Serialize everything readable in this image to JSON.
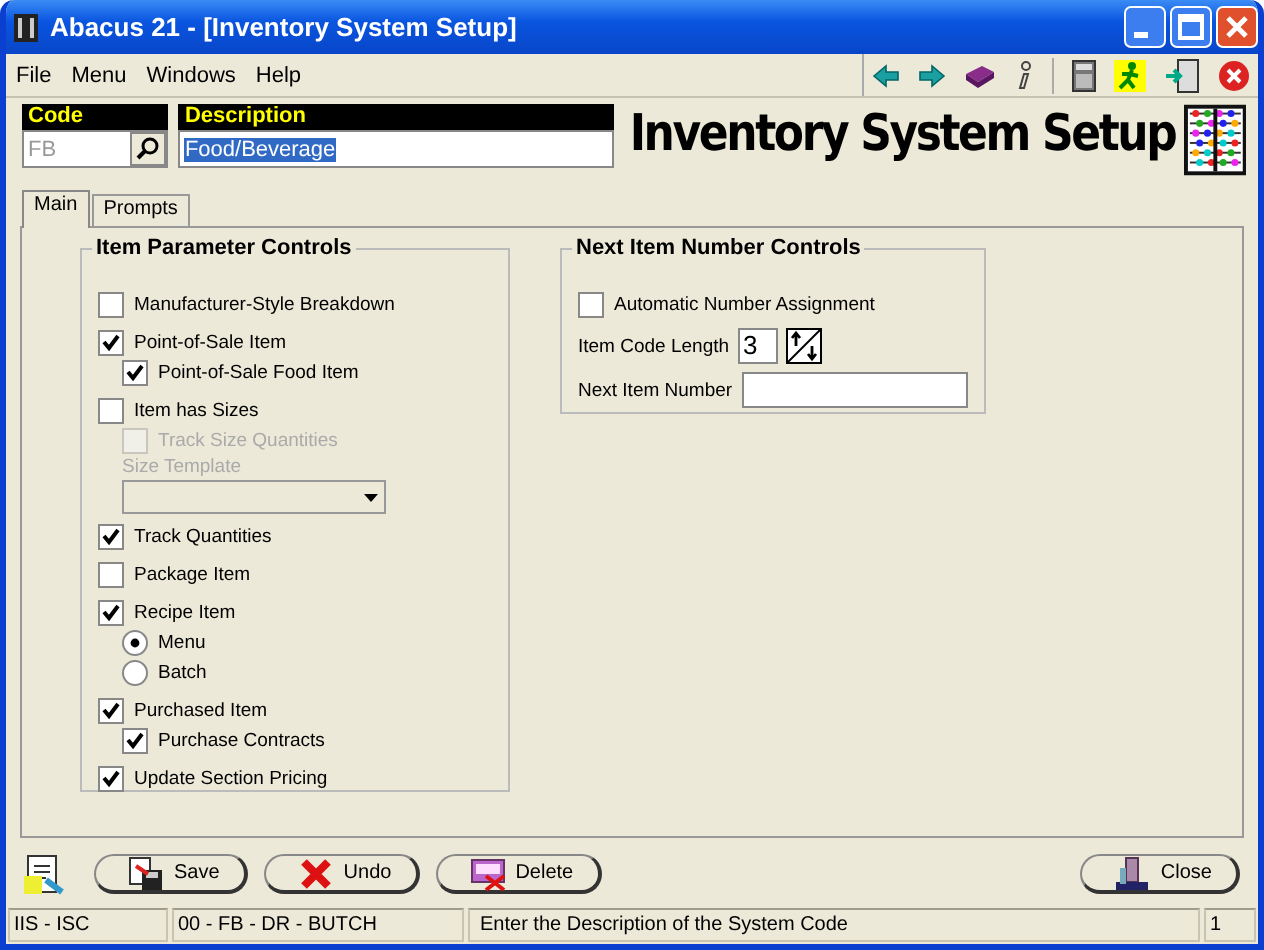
{
  "window": {
    "title": "Abacus 21 - [Inventory System Setup]"
  },
  "menu": [
    "File",
    "Menu",
    "Windows",
    "Help"
  ],
  "header": {
    "code_label": "Code",
    "code_value": "FB",
    "description_label": "Description",
    "description_value": "Food/Beverage",
    "heading": "Inventory System Setup"
  },
  "tabs": [
    {
      "label": "Main",
      "selected": true
    },
    {
      "label": "Prompts",
      "selected": false
    }
  ],
  "item_parameter_controls": {
    "title": "Item Parameter Controls",
    "items": [
      {
        "kind": "checkbox",
        "label": "Manufacturer-Style Breakdown",
        "checked": false,
        "disabled": false
      },
      {
        "kind": "checkbox",
        "label": "Point-of-Sale Item",
        "checked": true,
        "disabled": false,
        "children": [
          {
            "kind": "checkbox",
            "label": "Point-of-Sale Food Item",
            "checked": true,
            "disabled": false
          }
        ]
      },
      {
        "kind": "checkbox",
        "label": "Item has Sizes",
        "checked": false,
        "disabled": false,
        "children": [
          {
            "kind": "checkbox",
            "label": "Track Size Quantities",
            "checked": false,
            "disabled": true
          },
          {
            "kind": "select",
            "label": "Size Template",
            "disabled": true
          }
        ]
      },
      {
        "kind": "checkbox",
        "label": "Track Quantities",
        "checked": true,
        "disabled": false
      },
      {
        "kind": "checkbox",
        "label": "Package Item",
        "checked": false,
        "disabled": false
      },
      {
        "kind": "checkbox",
        "label": "Recipe Item",
        "checked": true,
        "disabled": false,
        "children": [
          {
            "kind": "radio",
            "label": "Menu",
            "selected": true
          },
          {
            "kind": "radio",
            "label": "Batch",
            "selected": false
          }
        ]
      },
      {
        "kind": "checkbox",
        "label": "Purchased Item",
        "checked": true,
        "disabled": false,
        "children": [
          {
            "kind": "checkbox",
            "label": "Purchase Contracts",
            "checked": true,
            "disabled": false
          }
        ]
      },
      {
        "kind": "checkbox",
        "label": "Update Section Pricing",
        "checked": true,
        "disabled": false
      }
    ]
  },
  "next_item_number_controls": {
    "title": "Next Item Number Controls",
    "automatic": {
      "label": "Automatic Number Assignment",
      "checked": false
    },
    "code_length": {
      "label": "Item Code Length",
      "value": "3"
    },
    "next_number": {
      "label": "Next Item Number"
    }
  },
  "buttons": [
    {
      "kind": "save",
      "label": "Save"
    },
    {
      "kind": "undo",
      "label": "Undo"
    },
    {
      "kind": "delete",
      "label": "Delete"
    },
    {
      "kind": "close",
      "label": "Close"
    }
  ],
  "status_bar": [
    "IIS - ISC",
    "00 - FB - DR - BUTCH",
    "Enter the Description of the System Code",
    "1"
  ]
}
